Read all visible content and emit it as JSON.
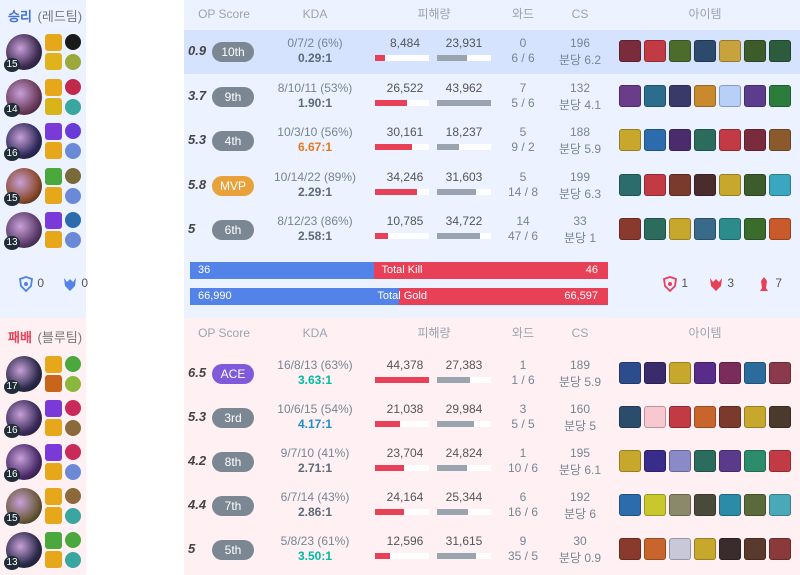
{
  "colors": {
    "win_bg": "#ecf2ff",
    "lose_bg": "#fff1f3",
    "blue": "#5383e8",
    "red": "#e84057",
    "mvp": "#e9a23b",
    "ace": "#7f5bdb"
  },
  "headers": {
    "op_score": "OP Score",
    "kda": "KDA",
    "damage": "피해량",
    "wards": "와드",
    "cs": "CS",
    "items": "아이템"
  },
  "win_team": {
    "result": "승리",
    "side": "(레드팀)",
    "players": [
      {
        "level": "15",
        "score": "0.9",
        "badge": "10th",
        "badge_type": "normal",
        "kda": "0/7/2 (6%)",
        "ratio": "0.29:1",
        "ratio_color": "#5c6a77",
        "dealt": "8,484",
        "taken": "23,931",
        "dealt_frac": 0.19,
        "taken_frac": 0.55,
        "wards": "0",
        "wards2": "6 / 6",
        "cs": "196",
        "cs_min": "분당 6.2",
        "me": true,
        "champ": "#3b2a4f",
        "spells": [
          "#e6a81a",
          "#e0b31c"
        ],
        "runes": [
          "#1a1a1a",
          "#9aa83c"
        ],
        "items": [
          "#7a2c3c",
          "#c23a44",
          "#4c6c2c",
          "#2c4a6b",
          "#c8a23c",
          "#3c5c2c",
          "#2c5c3c"
        ]
      },
      {
        "level": "14",
        "score": "3.7",
        "badge": "9th",
        "badge_type": "normal",
        "kda": "8/10/11 (53%)",
        "ratio": "1.90:1",
        "ratio_color": "#5c6a77",
        "dealt": "26,522",
        "taken": "43,962",
        "dealt_frac": 0.6,
        "taken_frac": 1.0,
        "wards": "7",
        "wards2": "5 / 6",
        "cs": "132",
        "cs_min": "분당 4.1",
        "me": false,
        "champ": "#6a3a5a",
        "spells": [
          "#e6a81a",
          "#d8b41a"
        ],
        "runes": [
          "#c0294a",
          "#3aa6a0"
        ],
        "items": [
          "#6a3c8a",
          "#2c6c8c",
          "#3a3a6a",
          "#c88a2c",
          "#b8cff8",
          "#5c3c8c",
          "#2c7c3c"
        ]
      },
      {
        "level": "16",
        "score": "5.3",
        "badge": "4th",
        "badge_type": "normal",
        "kda": "10/3/10 (56%)",
        "ratio": "6.67:1",
        "ratio_color": "#e37a1f",
        "dealt": "30,161",
        "taken": "18,237",
        "dealt_frac": 0.68,
        "taken_frac": 0.41,
        "wards": "5",
        "wards2": "9 / 2",
        "cs": "188",
        "cs_min": "분당 5.9",
        "me": false,
        "champ": "#2e2a5a",
        "spells": [
          "#7a3ad8",
          "#e6a81a"
        ],
        "runes": [
          "#6a3ad8",
          "#6a8ad8"
        ],
        "items": [
          "#c8a82c",
          "#2c6cac",
          "#4a2c6c",
          "#2c6c5c",
          "#c23a44",
          "#7a2c3c",
          "#8a5a2c"
        ]
      },
      {
        "level": "15",
        "score": "5.8",
        "badge": "MVP",
        "badge_type": "mvp",
        "kda": "10/14/22 (89%)",
        "ratio": "2.29:1",
        "ratio_color": "#5c6a77",
        "dealt": "34,246",
        "taken": "31,603",
        "dealt_frac": 0.77,
        "taken_frac": 0.72,
        "wards": "5",
        "wards2": "14 / 8",
        "cs": "199",
        "cs_min": "분당 6.3",
        "me": false,
        "champ": "#8a4a2a",
        "spells": [
          "#4aa83c",
          "#e6a81a"
        ],
        "runes": [
          "#7a6a3a",
          "#6a8ad8"
        ],
        "items": [
          "#2c6c6c",
          "#c23a44",
          "#7a3a2c",
          "#4a2c2c",
          "#c8a82c",
          "#3c5c2c",
          "#3aa6c0"
        ]
      },
      {
        "level": "13",
        "score": "5",
        "badge": "6th",
        "badge_type": "normal",
        "kda": "8/12/23 (86%)",
        "ratio": "2.58:1",
        "ratio_color": "#5c6a77",
        "dealt": "10,785",
        "taken": "34,722",
        "dealt_frac": 0.24,
        "taken_frac": 0.79,
        "wards": "14",
        "wards2": "47 / 6",
        "cs": "33",
        "cs_min": "분당 1",
        "me": false,
        "champ": "#5a3a6a",
        "spells": [
          "#7a3ad8",
          "#e6a81a"
        ],
        "runes": [
          "#2c6cac",
          "#6a8ad8"
        ],
        "items": [
          "#8a3a2c",
          "#2c6c5c",
          "#c8a82c",
          "#3a6a8a",
          "#2c8c8c",
          "#3a6c2c",
          "#c85a2c"
        ]
      }
    ],
    "objectives": [
      {
        "icon": "baron-icon",
        "value": "0"
      },
      {
        "icon": "dragon-icon",
        "value": "0"
      }
    ]
  },
  "totals": {
    "kill_left": "36",
    "kill_label": "Total Kill",
    "kill_right": "46",
    "kill_blue_frac": 0.439,
    "gold_left": "66,990",
    "gold_label": "Total Gold",
    "gold_right": "66,597",
    "gold_blue_frac": 0.501
  },
  "lose_objectives": [
    {
      "icon": "baron-icon",
      "value": "1"
    },
    {
      "icon": "dragon-icon",
      "value": "3"
    },
    {
      "icon": "tower-icon",
      "value": "7"
    }
  ],
  "lose_team": {
    "result": "패배",
    "side": "(블루팀)",
    "players": [
      {
        "level": "17",
        "score": "6.5",
        "badge": "ACE",
        "badge_type": "ace",
        "kda": "16/8/13 (63%)",
        "ratio": "3.63:1",
        "ratio_color": "#00bba3",
        "dealt": "44,378",
        "taken": "27,383",
        "dealt_frac": 1.0,
        "taken_frac": 0.62,
        "wards": "1",
        "wards2": "1 / 6",
        "cs": "189",
        "cs_min": "분당 5.9",
        "champ": "#2a2a4a",
        "spells": [
          "#e6a81a",
          "#c8651a"
        ],
        "runes": [
          "#4aa83c",
          "#8ab83c"
        ],
        "items": [
          "#2c4c8c",
          "#3a2c6c",
          "#c8a82c",
          "#5a2c8a",
          "#7a2c5a",
          "#2c6c9c",
          "#8a3a4a"
        ]
      },
      {
        "level": "16",
        "score": "5.3",
        "badge": "3rd",
        "badge_type": "normal",
        "kda": "10/6/15 (54%)",
        "ratio": "4.17:1",
        "ratio_color": "#1f8ecd",
        "dealt": "21,038",
        "taken": "29,984",
        "dealt_frac": 0.47,
        "taken_frac": 0.68,
        "wards": "3",
        "wards2": "5 / 5",
        "cs": "160",
        "cs_min": "분당 5",
        "champ": "#3a2a5a",
        "spells": [
          "#7a3ad8",
          "#e6a81a"
        ],
        "runes": [
          "#c82a5a",
          "#8a6a3a"
        ],
        "items": [
          "#2c4c6c",
          "#f8c8d0",
          "#c23a44",
          "#c8652c",
          "#7a3a2c",
          "#c8a82c",
          "#4a3a2c"
        ]
      },
      {
        "level": "16",
        "score": "4.2",
        "badge": "8th",
        "badge_type": "normal",
        "kda": "9/7/10 (41%)",
        "ratio": "2.71:1",
        "ratio_color": "#5c6a77",
        "dealt": "23,704",
        "taken": "24,824",
        "dealt_frac": 0.53,
        "taken_frac": 0.56,
        "wards": "1",
        "wards2": "10 / 6",
        "cs": "195",
        "cs_min": "분당 6.1",
        "champ": "#4a2a6a",
        "spells": [
          "#7a3ad8",
          "#e6a81a"
        ],
        "runes": [
          "#c82a5a",
          "#6a8ad8"
        ],
        "items": [
          "#c8a82c",
          "#3a2c8a",
          "#8a8ac8",
          "#2c6c5c",
          "#5a3a8a",
          "#2c8c6c",
          "#c23a44"
        ]
      },
      {
        "level": "15",
        "score": "4.4",
        "badge": "7th",
        "badge_type": "normal",
        "kda": "6/7/14 (43%)",
        "ratio": "2.86:1",
        "ratio_color": "#5c6a77",
        "dealt": "24,164",
        "taken": "25,344",
        "dealt_frac": 0.54,
        "taken_frac": 0.57,
        "wards": "6",
        "wards2": "16 / 6",
        "cs": "192",
        "cs_min": "분당 6",
        "champ": "#6a5a3a",
        "spells": [
          "#e6a81a",
          "#e6a81a"
        ],
        "runes": [
          "#8a6a3a",
          "#3aa6a0"
        ],
        "items": [
          "#2c6cac",
          "#c8c82c",
          "#8a8a6a",
          "#4a4a3a",
          "#2c8ca8",
          "#5a6a3a",
          "#4aa8b8"
        ]
      },
      {
        "level": "13",
        "score": "5",
        "badge": "5th",
        "badge_type": "normal",
        "kda": "5/8/23 (61%)",
        "ratio": "3.50:1",
        "ratio_color": "#00bba3",
        "dealt": "12,596",
        "taken": "31,615",
        "dealt_frac": 0.28,
        "taken_frac": 0.72,
        "wards": "9",
        "wards2": "35 / 5",
        "cs": "30",
        "cs_min": "분당 0.9",
        "champ": "#2a2a4a",
        "spells": [
          "#4aa83c",
          "#e6a81a"
        ],
        "runes": [
          "#4aa83c",
          "#3aa6a0"
        ],
        "items": [
          "#8a3a2c",
          "#c8652c",
          "#c8c8d8",
          "#c8a82c",
          "#3a2c2c",
          "#5a3a2c",
          "#8a3a3a"
        ]
      }
    ]
  }
}
